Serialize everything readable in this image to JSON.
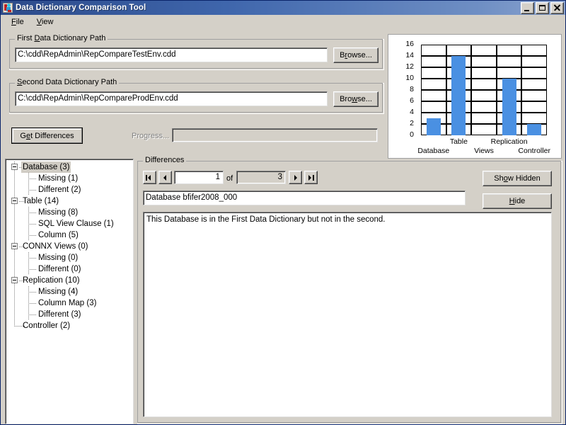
{
  "window": {
    "title": "Data Dictionary Comparison Tool",
    "icon": "app-icon",
    "minimize_label": "Minimize",
    "maximize_label": "Maximize",
    "close_label": "Close"
  },
  "menu": {
    "items": [
      {
        "label": "File",
        "accel": "F"
      },
      {
        "label": "View",
        "accel": "V"
      }
    ]
  },
  "first_path": {
    "group_title": "First Data Dictionary Path",
    "group_title_pre": "First ",
    "group_title_accel": "D",
    "group_title_post": "ata Dictionary Path",
    "value": "C:\\cdd\\RepAdmin\\RepCompareTestEnv.cdd",
    "placeholder": "",
    "browse_label": "Browse...",
    "browse_pre": "B",
    "browse_accel": "r",
    "browse_post": "owse..."
  },
  "second_path": {
    "group_title": "Second Data Dictionary Path",
    "group_title_accel": "S",
    "group_title_post": "econd Data Dictionary Path",
    "value": "C:\\cdd\\RepAdmin\\RepCompareProdEnv.cdd",
    "placeholder": "",
    "browse_label": "Browse...",
    "browse_pre": "Bro",
    "browse_accel": "w",
    "browse_post": "se..."
  },
  "actions": {
    "get_differences_pre": "G",
    "get_differences_accel": "e",
    "get_differences_post": "t Differences",
    "get_differences_label": "Get Differences",
    "progress_label": "Progress...",
    "progress_value": 0
  },
  "chart_data": {
    "type": "bar",
    "title": "",
    "xlabel": "",
    "ylabel": "",
    "categories": [
      "Database",
      "Table",
      "Views",
      "Replication",
      "Controller"
    ],
    "values": [
      3,
      14,
      0,
      10,
      2
    ],
    "ylim": [
      0,
      16
    ],
    "yticks": [
      16,
      14,
      12,
      10,
      8,
      6,
      4,
      2,
      0
    ],
    "grid": true,
    "legend": "none",
    "bar_color": "#4a90e2",
    "label_rows": {
      "top": [
        "Table",
        "Replication"
      ],
      "bottom": [
        "Database",
        "Views",
        "Controller"
      ]
    }
  },
  "tree": {
    "selected": "Database (3)",
    "nodes": [
      {
        "label": "Database (3)",
        "level": 0,
        "expandable": true,
        "selected": true
      },
      {
        "label": "Missing (1)",
        "level": 1,
        "expandable": false,
        "selected": false
      },
      {
        "label": "Different (2)",
        "level": 1,
        "expandable": false,
        "selected": false
      },
      {
        "label": "Table (14)",
        "level": 0,
        "expandable": true,
        "selected": false
      },
      {
        "label": "Missing (8)",
        "level": 1,
        "expandable": false,
        "selected": false
      },
      {
        "label": "SQL View Clause (1)",
        "level": 1,
        "expandable": false,
        "selected": false
      },
      {
        "label": "Column (5)",
        "level": 1,
        "expandable": false,
        "selected": false
      },
      {
        "label": "CONNX Views (0)",
        "level": 0,
        "expandable": true,
        "selected": false
      },
      {
        "label": "Missing (0)",
        "level": 1,
        "expandable": false,
        "selected": false
      },
      {
        "label": "Different (0)",
        "level": 1,
        "expandable": false,
        "selected": false
      },
      {
        "label": "Replication (10)",
        "level": 0,
        "expandable": true,
        "selected": false
      },
      {
        "label": "Missing (4)",
        "level": 1,
        "expandable": false,
        "selected": false
      },
      {
        "label": "Column Map (3)",
        "level": 1,
        "expandable": false,
        "selected": false
      },
      {
        "label": "Different (3)",
        "level": 1,
        "expandable": false,
        "selected": false
      },
      {
        "label": "Controller (2)",
        "level": 0,
        "expandable": false,
        "selected": false
      }
    ]
  },
  "differences": {
    "group_title": "Differences",
    "nav": {
      "first_label": "First",
      "prev_label": "Previous",
      "next_label": "Next",
      "last_label": "Last",
      "current": "1",
      "of_label": "of",
      "total": "3"
    },
    "item_title": "Database bfifer2008_000",
    "description": "This Database is in the First Data Dictionary but not in the second.",
    "show_hidden_pre": "Sh",
    "show_hidden_accel": "o",
    "show_hidden_post": "w Hidden",
    "show_hidden_label": "Show Hidden",
    "hide_accel": "H",
    "hide_post": "ide",
    "hide_label": "Hide"
  }
}
